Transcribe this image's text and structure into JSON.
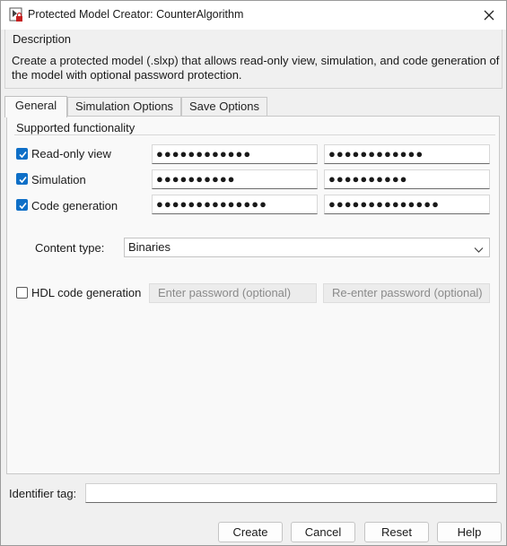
{
  "window": {
    "title": "Protected Model Creator: CounterAlgorithm",
    "icons": {
      "app": "protected-model-icon",
      "close": "close-icon"
    }
  },
  "description": {
    "header": "Description",
    "text": "Create a protected model (.slxp) that allows read-only view, simulation, and code generation of the model with optional password protection."
  },
  "tabs": [
    {
      "label": "General",
      "active": true
    },
    {
      "label": "Simulation Options",
      "active": false
    },
    {
      "label": "Save Options",
      "active": false
    }
  ],
  "general": {
    "supported_label": "Supported functionality",
    "rows": [
      {
        "label": "Read-only view",
        "checked": true,
        "password": "●●●●●●●●●●●●",
        "confirm": "●●●●●●●●●●●●"
      },
      {
        "label": "Simulation",
        "checked": true,
        "password": "●●●●●●●●●●",
        "confirm": "●●●●●●●●●●"
      },
      {
        "label": "Code generation",
        "checked": true,
        "password": "●●●●●●●●●●●●●●",
        "confirm": "●●●●●●●●●●●●●●"
      }
    ],
    "content_type_label": "Content type:",
    "content_type_value": "Binaries",
    "hdl": {
      "label": "HDL code generation",
      "checked": false,
      "password_placeholder": "Enter password (optional)",
      "confirm_placeholder": "Re-enter password (optional)"
    }
  },
  "identifier_tag": {
    "label": "Identifier tag:",
    "value": ""
  },
  "buttons": {
    "create": "Create",
    "cancel": "Cancel",
    "reset": "Reset",
    "help": "Help"
  },
  "colors": {
    "checkbox_checked": "#0e6fc7",
    "window_bg": "#f0f0f0",
    "panel_bg": "#f9f9f9"
  }
}
